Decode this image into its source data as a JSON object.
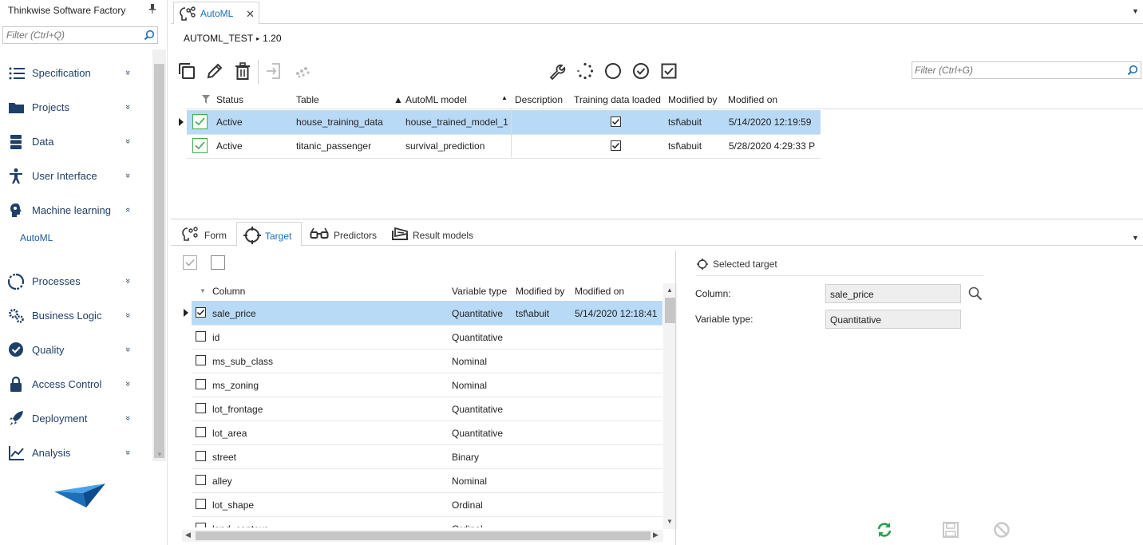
{
  "app": {
    "title": "Thinkwise Software Factory"
  },
  "nav": {
    "filter_placeholder": "Filter (Ctrl+Q)",
    "items": [
      {
        "label": "Specification",
        "icon": "list-icon",
        "chevron": "»"
      },
      {
        "label": "Projects",
        "icon": "folder-icon",
        "chevron": "»"
      },
      {
        "label": "Data",
        "icon": "database-icon",
        "chevron": "»"
      },
      {
        "label": "User Interface",
        "icon": "person-icon",
        "chevron": "»"
      },
      {
        "label": "Machine learning",
        "icon": "brain-icon",
        "chevron": "«"
      },
      {
        "label": "Processes",
        "icon": "cycle-icon",
        "chevron": "»"
      },
      {
        "label": "Business Logic",
        "icon": "gears-icon",
        "chevron": "»"
      },
      {
        "label": "Quality",
        "icon": "badge-check-icon",
        "chevron": "»"
      },
      {
        "label": "Access Control",
        "icon": "lock-icon",
        "chevron": "»"
      },
      {
        "label": "Deployment",
        "icon": "rocket-icon",
        "chevron": "»"
      },
      {
        "label": "Analysis",
        "icon": "chart-line-icon",
        "chevron": "»"
      }
    ],
    "sub_item": "AutoML"
  },
  "tabs": {
    "active": "AutoML",
    "close": "✕"
  },
  "breadcrumb": {
    "project": "AUTOML_TEST",
    "version": "1.20",
    "separator": "▸"
  },
  "toolbar": {
    "filter_placeholder": "Filter (Ctrl+G)"
  },
  "top_grid": {
    "columns": [
      "Status",
      "Table",
      "AutoML model",
      "Description",
      "Training data loaded",
      "Modified by",
      "Modified on"
    ],
    "rows": [
      {
        "status": "Active",
        "table": "house_training_data",
        "model": "house_trained_model_1",
        "description": "",
        "loaded": true,
        "modified_by": "tsf\\abuit",
        "modified_on": "5/14/2020 12:19:59"
      },
      {
        "status": "Active",
        "table": "titanic_passenger",
        "model": "survival_prediction",
        "description": "",
        "loaded": true,
        "modified_by": "tsf\\abuit",
        "modified_on": "5/28/2020 4:29:33 P"
      }
    ]
  },
  "detail_tabs": [
    "Form",
    "Target",
    "Predictors",
    "Result models"
  ],
  "target_grid": {
    "columns": [
      "Column",
      "Variable type",
      "Modified by",
      "Modified on"
    ],
    "rows": [
      {
        "checked": true,
        "column": "sale_price",
        "type": "Quantitative",
        "modified_by": "tsf\\abuit",
        "modified_on": "5/14/2020 12:18:41"
      },
      {
        "checked": false,
        "column": "id",
        "type": "Quantitative",
        "modified_by": "",
        "modified_on": ""
      },
      {
        "checked": false,
        "column": "ms_sub_class",
        "type": "Nominal",
        "modified_by": "",
        "modified_on": ""
      },
      {
        "checked": false,
        "column": "ms_zoning",
        "type": "Nominal",
        "modified_by": "",
        "modified_on": ""
      },
      {
        "checked": false,
        "column": "lot_frontage",
        "type": "Quantitative",
        "modified_by": "",
        "modified_on": ""
      },
      {
        "checked": false,
        "column": "lot_area",
        "type": "Quantitative",
        "modified_by": "",
        "modified_on": ""
      },
      {
        "checked": false,
        "column": "street",
        "type": "Binary",
        "modified_by": "",
        "modified_on": ""
      },
      {
        "checked": false,
        "column": "alley",
        "type": "Nominal",
        "modified_by": "",
        "modified_on": ""
      },
      {
        "checked": false,
        "column": "lot_shape",
        "type": "Ordinal",
        "modified_by": "",
        "modified_on": ""
      },
      {
        "checked": false,
        "column": "land_contour",
        "type": "Ordinal",
        "modified_by": "",
        "modified_on": ""
      }
    ]
  },
  "form": {
    "group_label": "Selected target",
    "column_label": "Column:",
    "column_value": "sale_price",
    "type_label": "Variable type:",
    "type_value": "Quantitative"
  },
  "colors": {
    "accent": "#1e6fb8",
    "selection": "#b9daf6",
    "active_green": "#3fae49",
    "nav_text": "#1f3f66",
    "refresh_green": "#2aa14a"
  }
}
